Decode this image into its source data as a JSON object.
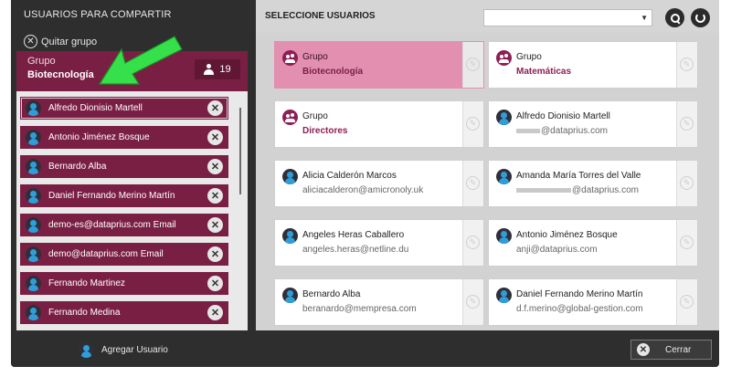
{
  "left_panel": {
    "title": "USUARIOS PARA COMPARTIR",
    "remove_group_label": "Quitar grupo",
    "group": {
      "label": "Grupo",
      "name": "Biotecnología",
      "count": "19"
    },
    "users": [
      "Alfredo Dionisio Martell",
      "Antonio Jiménez Bosque",
      "Bernardo Alba",
      "Daniel Fernando Merino Martín",
      "demo-es@dataprius.com Email",
      "demo@dataprius.com Email",
      "Fernando Martinez",
      "Fernando Medina"
    ]
  },
  "right_panel": {
    "title": "SELECCIONE USUARIOS",
    "search_value": "",
    "cards": [
      {
        "type": "group",
        "line1": "Grupo",
        "line2": "Biotecnología",
        "active": true
      },
      {
        "type": "group",
        "line1": "Grupo",
        "line2": "Matemáticas",
        "active": false
      },
      {
        "type": "group",
        "line1": "Grupo",
        "line2": "Directores",
        "active": false
      },
      {
        "type": "user",
        "line1": "Alfredo Dionisio Martell",
        "line2": "@dataprius.com",
        "redacted": true,
        "active": false
      },
      {
        "type": "user",
        "line1": "Alicia Calderón Marcos",
        "line2": "aliciacalderon@amicronoly.uk",
        "active": false
      },
      {
        "type": "user",
        "line1": "Amanda María Torres del Valle",
        "line2": "@dataprius.com",
        "redacted": true,
        "active": false
      },
      {
        "type": "user",
        "line1": "Angeles Heras Caballero",
        "line2": "angeles.heras@netline.du",
        "active": false
      },
      {
        "type": "user",
        "line1": "Antonio Jiménez Bosque",
        "line2": "anji@dataprius.com",
        "active": false
      },
      {
        "type": "user",
        "line1": "Bernardo Alba",
        "line2": "beranardo@mempresa.com",
        "active": false
      },
      {
        "type": "user",
        "line1": "Daniel Fernando Merino Martín",
        "line2": "d.f.merino@global-gestion.com",
        "active": false
      }
    ]
  },
  "bottom": {
    "add_user_label": "Agregar Usuario",
    "close_label": "Cerrar"
  },
  "icons": {
    "remove": "close-circle-icon",
    "user": "user-avatar-icon",
    "group": "group-icon",
    "edit": "pencil-icon",
    "search": "search-icon",
    "refresh": "refresh-icon",
    "annotation": "green-arrow-icon"
  },
  "colors": {
    "accent": "#7a1f44",
    "active_card": "#e28fb0",
    "dark_bg": "#2e2e2e",
    "annotation": "#35e04a"
  }
}
